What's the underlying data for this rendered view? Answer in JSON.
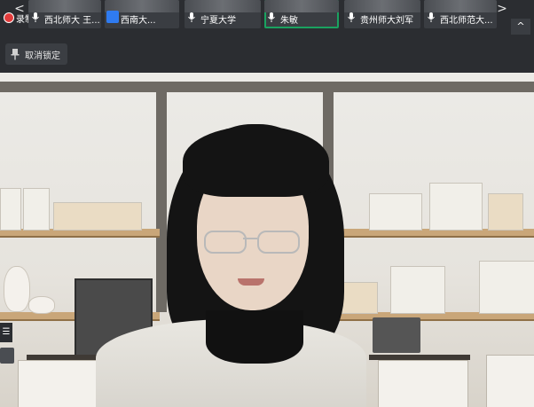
{
  "strip": {
    "recording_label": "录制中",
    "thumbnails": [
      {
        "label": "西北师大 王..."
      },
      {
        "label": "西南大..."
      },
      {
        "label": "宁夏大学"
      },
      {
        "label": "朱敏"
      },
      {
        "label": "贵州师大刘军"
      },
      {
        "label": "西北师范大..."
      }
    ],
    "nav_left": "<",
    "nav_right": ">",
    "collapse": "^"
  },
  "toolbar": {
    "unlock_label": "取消锁定"
  },
  "colors": {
    "active_speaker": "#1aa260",
    "record": "#e23b3b",
    "avatar": "#2f7bf0"
  }
}
